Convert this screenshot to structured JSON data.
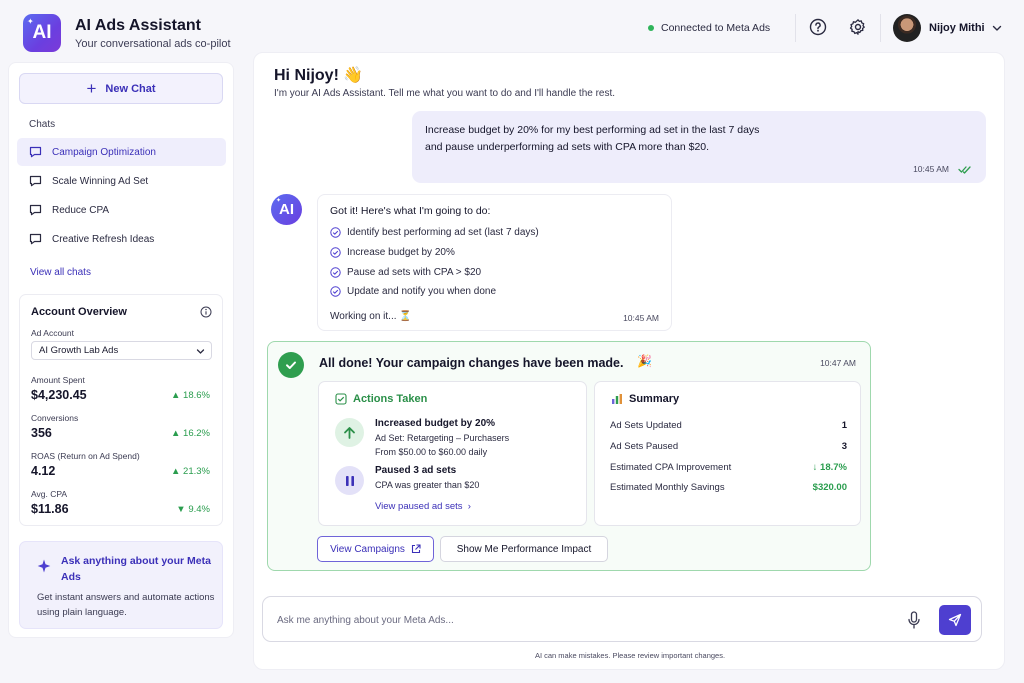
{
  "app": {
    "logo_text": "AI",
    "title": "AI Ads Assistant",
    "subtitle": "Your conversational ads co-pilot"
  },
  "header": {
    "connection_status": "Connected to Meta Ads",
    "status_color": "#2fb45a",
    "help_icon": "question-circle-icon",
    "settings_icon": "gear-icon",
    "user_name": "Nijoy Mithi"
  },
  "sidebar": {
    "new_chat_label": "New Chat",
    "chats_heading": "Chats",
    "chats": [
      {
        "label": "Campaign Optimization",
        "active": true
      },
      {
        "label": "Scale Winning Ad Set",
        "active": false
      },
      {
        "label": "Reduce CPA",
        "active": false
      },
      {
        "label": "Creative Refresh Ideas",
        "active": false
      }
    ],
    "view_all_label": "View all chats",
    "account_overview": {
      "title": "Account Overview",
      "ad_account_label": "Ad Account",
      "ad_account_value": "AI Growth Lab Ads",
      "metrics": [
        {
          "label": "Amount Spent",
          "value": "$4,230.45",
          "change": "▲ 18.6%"
        },
        {
          "label": "Conversions",
          "value": "356",
          "change": "▲ 16.2%"
        },
        {
          "label": "ROAS (Return on Ad Spend)",
          "value": "4.12",
          "change": "▲ 21.3%"
        },
        {
          "label": "Avg. CPA",
          "value": "$11.86",
          "change": "▼ 9.4%"
        }
      ]
    },
    "ask_card": {
      "title": "Ask anything about your Meta Ads",
      "body": "Get instant answers and automate actions using plain language."
    }
  },
  "main": {
    "greeting": "Hi Nijoy! 👋",
    "greeting_sub": "I'm your AI Ads Assistant. Tell me what you want to do and I'll handle the rest.",
    "user_message": {
      "line1": "Increase budget by 20% for my best performing ad set in the last 7 days",
      "line2": "and pause underperforming ad sets with CPA more than $20.",
      "time": "10:45 AM"
    },
    "ai_message": {
      "avatar_text": "AI",
      "intro": "Got it! Here's what I'm going to do:",
      "steps": [
        "Identify best performing ad set (last 7 days)",
        "Increase budget by 20%",
        "Pause ad sets with CPA > $20",
        "Update and notify you when done"
      ],
      "working": "Working on it... ⏳",
      "time": "10:45 AM"
    },
    "done_card": {
      "title": "All done! Your campaign changes have been made.",
      "emoji": "🎉",
      "time": "10:47 AM",
      "actions_title": "Actions Taken",
      "actions": [
        {
          "title": "Increased budget by 20%",
          "lines": [
            "Ad Set: Retargeting – Purchasers",
            "From $50.00 to $60.00 daily"
          ]
        },
        {
          "title": "Paused 3 ad sets",
          "lines": [
            "CPA was greater than $20"
          ]
        }
      ],
      "view_paused_label": "View paused ad sets",
      "summary_title": "Summary",
      "summary": [
        {
          "label": "Ad Sets Updated",
          "value": "1"
        },
        {
          "label": "Ad Sets Paused",
          "value": "3"
        },
        {
          "label": "Estimated CPA Improvement",
          "value": "↓ 18.7%"
        },
        {
          "label": "Estimated Monthly Savings",
          "value": "$320.00"
        }
      ],
      "view_campaigns_label": "View Campaigns",
      "impact_label": "Show Me Performance Impact"
    },
    "input": {
      "placeholder": "Ask me anything about your Meta Ads...",
      "value": ""
    },
    "disclaimer": "AI can make mistakes. Please review important changes."
  },
  "colors": {
    "accent": "#4e3fd0",
    "success": "#2f9e4f",
    "positive_change": "#2a9d4e"
  }
}
